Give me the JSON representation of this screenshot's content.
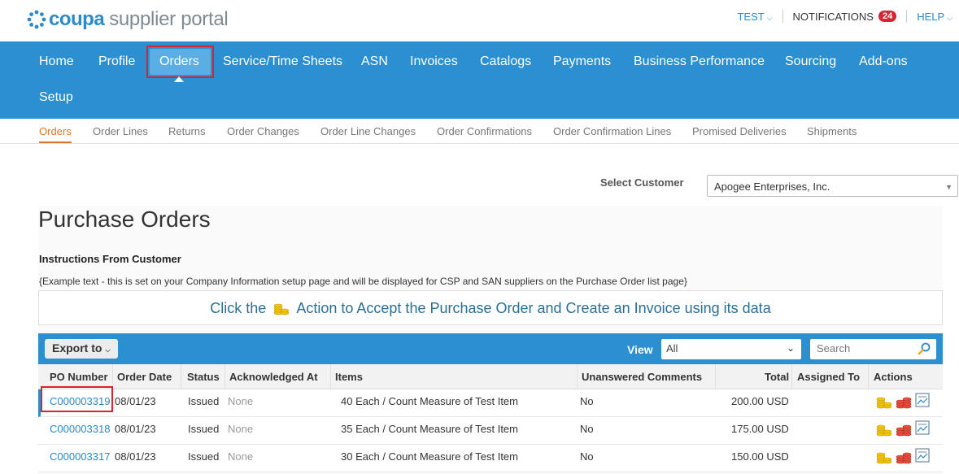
{
  "brand": {
    "word": "coupa",
    "sub": "supplier portal",
    "accent": "#2b8acb"
  },
  "topbar": {
    "user": "TEST",
    "notifications_label": "NOTIFICATIONS",
    "notifications_count": "24",
    "help": "HELP"
  },
  "mainnav": {
    "items": [
      "Home",
      "Profile",
      "Orders",
      "Service/Time Sheets",
      "ASN",
      "Invoices",
      "Catalogs",
      "Payments",
      "Business Performance",
      "Sourcing",
      "Add-ons",
      "Setup"
    ],
    "active": "Orders"
  },
  "subnav": {
    "items": [
      "Orders",
      "Order Lines",
      "Returns",
      "Order Changes",
      "Order Line Changes",
      "Order Confirmations",
      "Order Confirmation Lines",
      "Promised Deliveries",
      "Shipments"
    ],
    "active": "Orders"
  },
  "customer": {
    "label": "Select Customer",
    "value": "Apogee Enterprises, Inc."
  },
  "page": {
    "title": "Purchase Orders",
    "instructions_title": "Instructions From Customer",
    "instructions_text": "{Example text - this is set on your Company Information setup page and will be displayed for CSP and SAN suppliers on the Purchase Order list page}",
    "callout_before": "Click the",
    "callout_after": "Action to Accept the Purchase Order and Create an Invoice using its data"
  },
  "toolbar": {
    "export_label": "Export to",
    "view_label": "View",
    "view_value": "All",
    "search_placeholder": "Search"
  },
  "table": {
    "columns": [
      "PO Number",
      "Order Date",
      "Status",
      "Acknowledged At",
      "Items",
      "Unanswered Comments",
      "Total",
      "Assigned To",
      "Actions"
    ],
    "rows": [
      {
        "po": "C000003319",
        "date": "08/01/23",
        "status": "Issued",
        "ack": "None",
        "items": "40 Each / Count Measure of Test Item",
        "comments": "No",
        "total": "200.00 USD",
        "assigned": ""
      },
      {
        "po": "C000003318",
        "date": "08/01/23",
        "status": "Issued",
        "ack": "None",
        "items": "35 Each / Count Measure of Test Item",
        "comments": "No",
        "total": "175.00 USD",
        "assigned": ""
      },
      {
        "po": "C000003317",
        "date": "08/01/23",
        "status": "Issued",
        "ack": "None",
        "items": "30 Each / Count Measure of Test Item",
        "comments": "No",
        "total": "150.00 USD",
        "assigned": ""
      }
    ]
  }
}
